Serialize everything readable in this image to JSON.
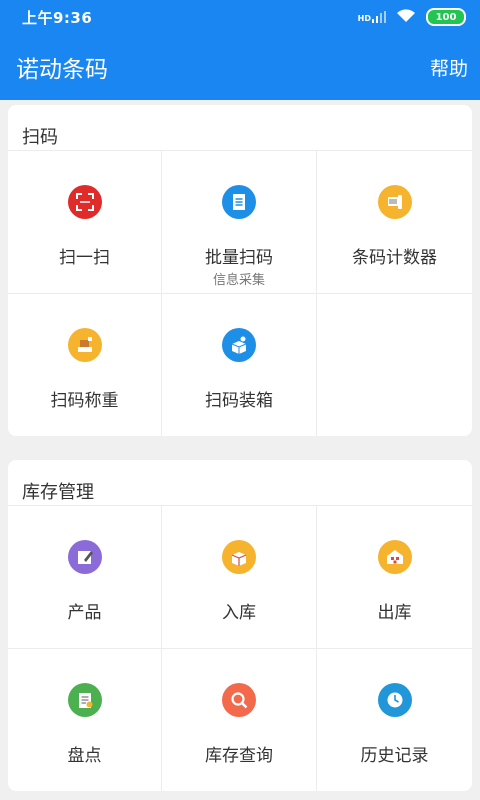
{
  "status_bar": {
    "time": "上午9:36",
    "hd": "HD",
    "battery": "100"
  },
  "app_bar": {
    "title": "诺动条码",
    "help": "帮助"
  },
  "sections": [
    {
      "title": "扫码",
      "items": [
        {
          "label": "扫一扫",
          "icon": "scan-icon",
          "color": "#e02b2b"
        },
        {
          "label": "批量扫码",
          "sublabel": "信息采集",
          "icon": "list-icon",
          "color": "#1e8fe6"
        },
        {
          "label": "条码计数器",
          "icon": "barcode-counter-icon",
          "color": "#f5b32e"
        },
        {
          "label": "扫码称重",
          "icon": "weigh-icon",
          "color": "#f5b32e"
        },
        {
          "label": "扫码装箱",
          "icon": "pack-box-icon",
          "color": "#1e8fe6"
        }
      ]
    },
    {
      "title": "库存管理",
      "items": [
        {
          "label": "产品",
          "icon": "product-edit-icon",
          "color": "#8b6bd8"
        },
        {
          "label": "入库",
          "icon": "inbound-box-icon",
          "color": "#f5b32e"
        },
        {
          "label": "出库",
          "icon": "warehouse-icon",
          "color": "#f5b32e"
        },
        {
          "label": "盘点",
          "icon": "checklist-icon",
          "color": "#4caf50"
        },
        {
          "label": "库存查询",
          "icon": "search-icon",
          "color": "#f26a4b"
        },
        {
          "label": "历史记录",
          "icon": "clock-icon",
          "color": "#2196d8"
        }
      ]
    }
  ]
}
